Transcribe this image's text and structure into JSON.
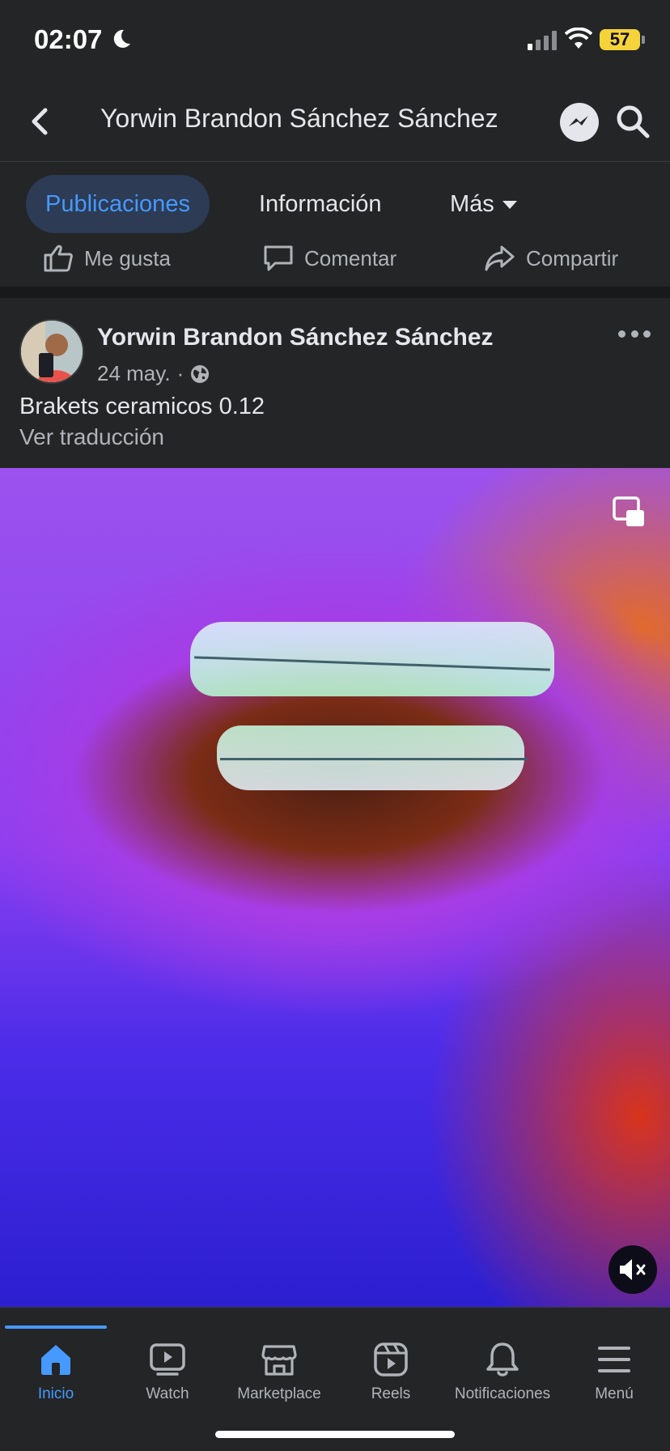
{
  "status_bar": {
    "time": "02:07",
    "battery": "57"
  },
  "header": {
    "title": "Yorwin Brandon Sánchez Sánchez"
  },
  "tabs": [
    {
      "label": "Publicaciones",
      "active": true
    },
    {
      "label": "Información",
      "active": false
    },
    {
      "label": "Más",
      "active": false
    }
  ],
  "actions": {
    "like": "Me gusta",
    "comment": "Comentar",
    "share": "Compartir"
  },
  "post": {
    "author": "Yorwin Brandon Sánchez Sánchez",
    "date": "24 may.",
    "separator": "·",
    "text": "Brakets ceramicos 0.12",
    "translate": "Ver traducción"
  },
  "bottom_nav": [
    {
      "label": "Inicio",
      "icon": "home-icon",
      "active": true
    },
    {
      "label": "Watch",
      "icon": "watch-icon",
      "active": false
    },
    {
      "label": "Marketplace",
      "icon": "marketplace-icon",
      "active": false
    },
    {
      "label": "Reels",
      "icon": "reels-icon",
      "active": false
    },
    {
      "label": "Notificaciones",
      "icon": "bell-icon",
      "active": false
    },
    {
      "label": "Menú",
      "icon": "menu-icon",
      "active": false
    }
  ],
  "colors": {
    "accent": "#4599ff",
    "background": "#242526",
    "battery": "#f5d33a"
  }
}
